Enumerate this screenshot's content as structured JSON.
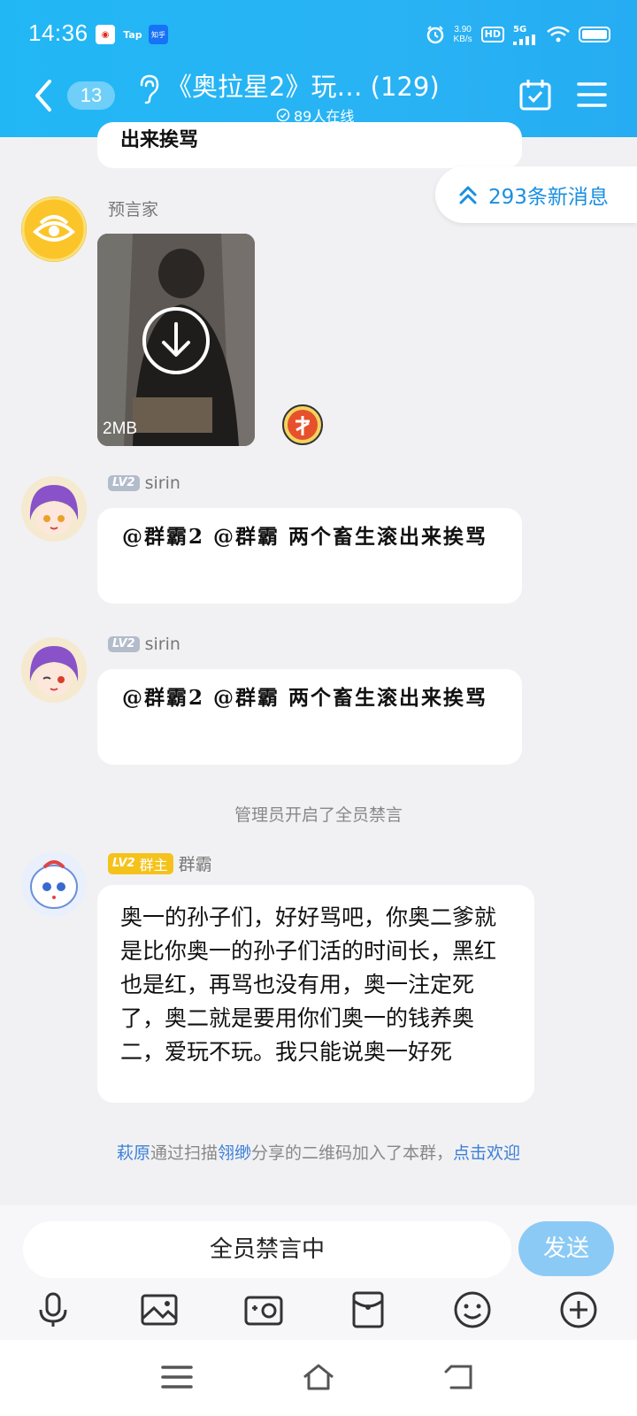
{
  "status_bar": {
    "time": "14:36",
    "apps": [
      "weibo-icon",
      "Tap",
      "知乎"
    ],
    "net_speed_value": "3.90",
    "net_speed_unit": "KB/s",
    "hd": "HD",
    "signal": "5G"
  },
  "header": {
    "unread_count": "13",
    "title": "《奥拉星2》玩… (129)",
    "online": "89人在线"
  },
  "new_messages": {
    "label": "293条新消息"
  },
  "messages": [
    {
      "sender": "预言家",
      "video_size": "2MB"
    },
    {
      "level": "LV2",
      "sender": "sirin",
      "text": "@群霸2 @群霸 两个畜生滚出来挨骂"
    },
    {
      "level": "LV2",
      "sender": "sirin",
      "text": "@群霸2 @群霸 两个畜生滚出来挨骂"
    },
    {
      "level": "LV2",
      "role": "群主",
      "sender": "群霸",
      "text": "奥一的孙子们，好好骂吧，你奥二爹就是比你奥一的孙子们活的时间长，黑红也是红，再骂也没有用，奥一注定死了，奥二就是要用你们奥一的钱养奥二，爱玩不玩。我只能说奥一好死"
    }
  ],
  "top_partial_text": "出来挨骂",
  "system": {
    "mute_notice": "管理员开启了全员禁言",
    "join_user": "萩原",
    "join_mid1": "通过扫描",
    "join_sharer": "翎缈",
    "join_mid2": "分享的二维码加入了本群，",
    "join_action": "点击欢迎"
  },
  "input": {
    "placeholder": "全员禁言中",
    "send_label": "发送"
  },
  "colors": {
    "header": "#29b3f4",
    "accent": "#1a8fe0",
    "send_disabled": "#8ccaf6",
    "owner_badge": "#f5c21c"
  }
}
